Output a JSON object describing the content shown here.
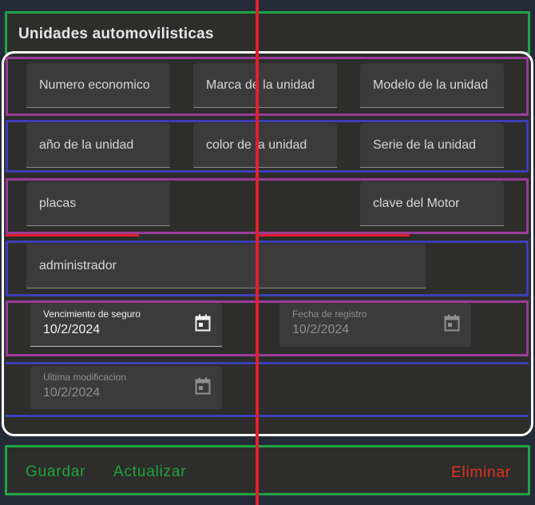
{
  "header": {
    "title": "Unidades automovilisticas"
  },
  "rows": {
    "row1": {
      "numero_economico": {
        "placeholder": "Numero economico"
      },
      "marca": {
        "placeholder": "Marca de la unidad"
      },
      "modelo": {
        "placeholder": "Modelo de la unidad"
      }
    },
    "row2": {
      "anio": {
        "placeholder": "año de la unidad"
      },
      "color": {
        "placeholder": "color de la unidad"
      },
      "serie": {
        "placeholder": "Serie de la unidad"
      }
    },
    "row3": {
      "placas": {
        "placeholder": "placas"
      },
      "clave_motor": {
        "placeholder": "clave del Motor"
      }
    },
    "row4": {
      "administrador": {
        "placeholder": "administrador"
      }
    },
    "row5": {
      "vencimiento": {
        "label": "Vencimiento de seguro",
        "value": "10/2/2024",
        "icon": "calendar-icon"
      },
      "registro": {
        "label": "Fecha de registro",
        "value": "10/2/2024",
        "icon": "calendar-icon"
      }
    },
    "row6": {
      "modificacion": {
        "label": "Ultima modificacion",
        "value": "10/2/2024",
        "icon": "calendar-icon"
      }
    }
  },
  "footer": {
    "guardar": "Guardar",
    "actualizar": "Actualizar",
    "eliminar": "Eliminar"
  },
  "colors": {
    "background": "#232c36",
    "card": "#2d2d2b",
    "field": "#3b3b3b",
    "primary_action": "#1fa43c",
    "danger_action": "#e2321f",
    "outline_green": "#22a447",
    "outline_purple": "#9a3c98",
    "outline_blue": "#3c3fb8",
    "guide_red": "#e3202a"
  }
}
